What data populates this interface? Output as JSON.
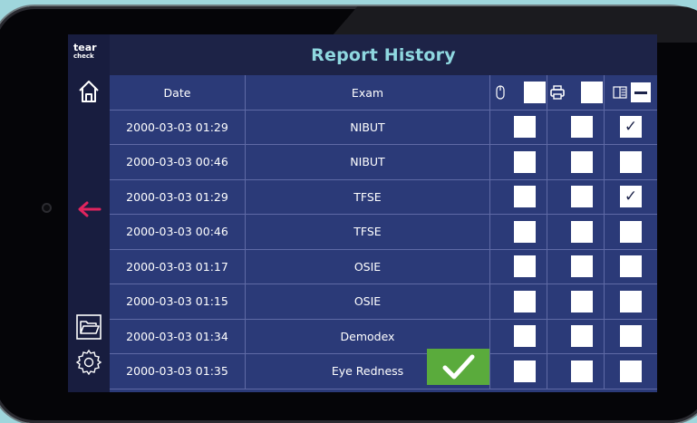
{
  "app": {
    "logo_line1": "tear",
    "logo_line2": "check",
    "title": "Report History"
  },
  "colors": {
    "accent": "#8fd8e0",
    "arrow": "#e0245e",
    "confirm": "#5aab3c",
    "row_bg": "#2b3a78"
  },
  "sidebar": {
    "icons": [
      "home-icon",
      "back-arrow-icon",
      "folder-icon",
      "settings-gear-icon"
    ]
  },
  "table": {
    "columns": {
      "date": "Date",
      "exam": "Exam",
      "col_a_icon": "mouse-icon",
      "col_b_icon": "printer-icon",
      "col_c_icon": "layout-icon"
    },
    "rows": [
      {
        "date": "2000-03-03 01:29",
        "exam": "NIBUT",
        "a": false,
        "b": false,
        "c": true
      },
      {
        "date": "2000-03-03 00:46",
        "exam": "NIBUT",
        "a": false,
        "b": false,
        "c": false
      },
      {
        "date": "2000-03-03 01:29",
        "exam": "TFSE",
        "a": false,
        "b": false,
        "c": true
      },
      {
        "date": "2000-03-03 00:46",
        "exam": "TFSE",
        "a": false,
        "b": false,
        "c": false
      },
      {
        "date": "2000-03-03 01:17",
        "exam": "OSIE",
        "a": false,
        "b": false,
        "c": false
      },
      {
        "date": "2000-03-03 01:15",
        "exam": "OSIE",
        "a": false,
        "b": false,
        "c": false
      },
      {
        "date": "2000-03-03 01:34",
        "exam": "Demodex",
        "a": false,
        "b": false,
        "c": false
      },
      {
        "date": "2000-03-03 01:35",
        "exam": "Eye Redness",
        "a": false,
        "b": false,
        "c": false
      }
    ],
    "check_glyph": "✓"
  },
  "confirm_button": {
    "icon": "checkmark-icon"
  }
}
